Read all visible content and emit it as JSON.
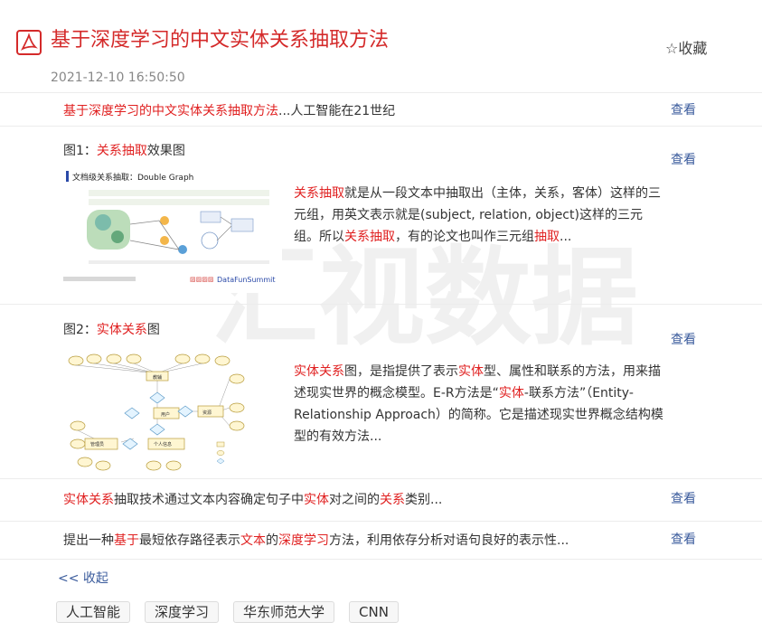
{
  "header": {
    "title": "基于深度学习的中文实体关系抽取方法",
    "favorite_label": "☆收藏",
    "date": "2021-12-10 16:50:50"
  },
  "rows": {
    "row1": {
      "hl": "基于深度学习的中文实体关系抽取方法",
      "rest": "...人工智能在21世纪",
      "view": "查看"
    },
    "fig1": {
      "label_pre": "图1：",
      "label_hl": "关系抽取",
      "label_post": "效果图",
      "view": "查看",
      "image_caption": "文档级关系抽取：Double Graph",
      "image_footer": "DataFunSummit",
      "desc": [
        {
          "t": "关系抽取",
          "h": true
        },
        {
          "t": "就是从一段文本中抽取出（主体，关系，客体）这样的三元组，用英文表示就是(subject, relation, object)这样的三元组。所以",
          "h": false
        },
        {
          "t": "关系抽取",
          "h": true
        },
        {
          "t": "，有的论文也叫作三元组",
          "h": false
        },
        {
          "t": "抽取",
          "h": true
        },
        {
          "t": "...",
          "h": false
        }
      ]
    },
    "fig2": {
      "label_pre": "图2：",
      "label_hl": "实体关系",
      "label_post": "图",
      "view": "查看",
      "image_nodes": [
        "教辅",
        "用户",
        "推荐",
        "资源",
        "管理员",
        "个人信息"
      ],
      "desc": [
        {
          "t": "实体关系",
          "h": true
        },
        {
          "t": "图，是指提供了表示",
          "h": false
        },
        {
          "t": "实体",
          "h": true
        },
        {
          "t": "型、属性和联系的方法，用来描述现实世界的概念模型。E-R方法是“",
          "h": false
        },
        {
          "t": "实体",
          "h": true
        },
        {
          "t": "-联系方法”（Entity-Relationship Approach）的简称。它是描述现实世界概念结构模型的有效方法...",
          "h": false
        }
      ]
    },
    "row4": {
      "parts": [
        {
          "t": "实体关系",
          "h": true
        },
        {
          "t": "抽取技术通过文本内容确定句子中",
          "h": false
        },
        {
          "t": "实体",
          "h": true
        },
        {
          "t": "对之间的",
          "h": false
        },
        {
          "t": "关系",
          "h": true
        },
        {
          "t": "类别...",
          "h": false
        }
      ],
      "view": "查看"
    },
    "row5": {
      "parts": [
        {
          "t": "提出一种",
          "h": false
        },
        {
          "t": "基于",
          "h": true
        },
        {
          "t": "最短依存路径表示",
          "h": false
        },
        {
          "t": "文本",
          "h": true
        },
        {
          "t": "的",
          "h": false
        },
        {
          "t": "深度学习",
          "h": true
        },
        {
          "t": "方法，利用依存分析对语句良好的表示性...",
          "h": false
        }
      ],
      "view": "查看"
    }
  },
  "collapse_label": "<< 收起",
  "tags": [
    "人工智能",
    "深度学习",
    "华东师范大学",
    "CNN"
  ],
  "watermark": "汇视数据",
  "colors": {
    "accent": "#d42a2a",
    "highlight": "#e02020",
    "link": "#3a5b9c"
  }
}
